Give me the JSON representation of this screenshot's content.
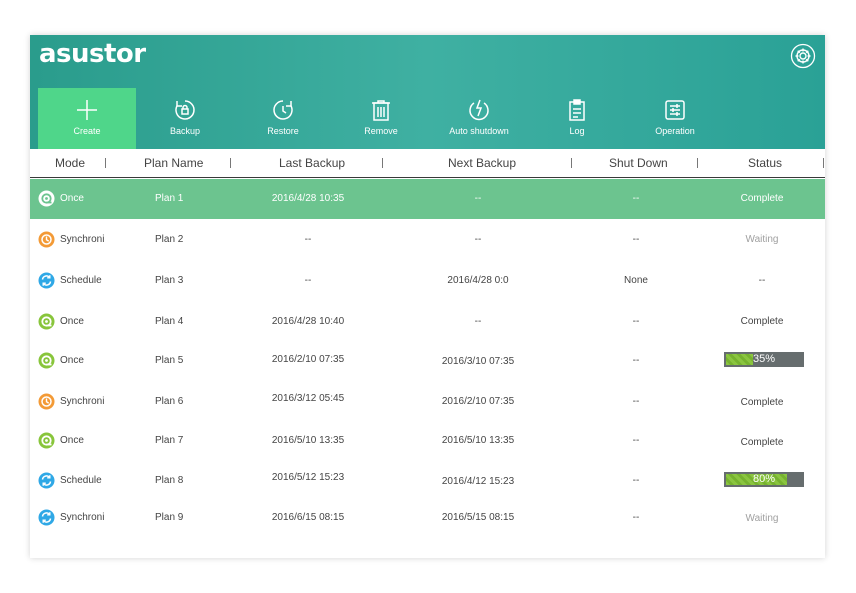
{
  "app": {
    "logo": "asustor"
  },
  "toolbar": {
    "create": "Create",
    "backup": "Backup",
    "restore": "Restore",
    "remove": "Remove",
    "auto_shutdown": "Auto shutdown",
    "log": "Log",
    "operation": "Operation"
  },
  "columns": {
    "mode": "Mode",
    "plan_name": "Plan Name",
    "last_backup": "Last Backup",
    "next_backup": "Next Backup",
    "shut_down": "Shut Down",
    "status": "Status"
  },
  "colors": {
    "once": "#88c53b",
    "synchroni": "#f39a36",
    "schedule": "#2fa8e6",
    "selected_row": "#6cc48f",
    "header": "#2a9c8c"
  },
  "rows": [
    {
      "mode": "Once",
      "mode_icon": "once-icon",
      "plan": "Plan 1",
      "last": "2016/4/28 10:35",
      "next": "--",
      "shutdown": "--",
      "status": "Complete",
      "status_color": "#ffffff"
    },
    {
      "mode": "Synchroni",
      "mode_icon": "synchroni-icon",
      "plan": "Plan 2",
      "last": "--",
      "next": "--",
      "shutdown": "--",
      "status": "Waiting",
      "status_color": "#a0a0a0"
    },
    {
      "mode": "Schedule",
      "mode_icon": "schedule-icon",
      "plan": "Plan 3",
      "last": "--",
      "next": "2016/4/28 0:0",
      "shutdown": "None",
      "status": "--",
      "status_color": "#444444"
    },
    {
      "mode": "Once",
      "mode_icon": "once-icon",
      "plan": "Plan 4",
      "last": "2016/4/28 10:40",
      "next": "--",
      "shutdown": "--",
      "status": "Complete",
      "status_color": "#444444"
    },
    {
      "mode": "Once",
      "mode_icon": "once-icon",
      "plan": "Plan 5",
      "last": "2016/2/10 07:35",
      "next": "2016/3/10 07:35",
      "shutdown": "--",
      "progress": "35%",
      "progress_value": 0.35
    },
    {
      "mode": "Synchroni",
      "mode_icon": "synchroni-icon",
      "plan": "Plan 6",
      "last": "2016/3/12  05:45",
      "next": "2016/2/10 07:35",
      "shutdown": "--",
      "status": "Complete",
      "status_color": "#444444"
    },
    {
      "mode": "Once",
      "mode_icon": "once-icon",
      "plan": "Plan 7",
      "last": "2016/5/10 13:35",
      "next": "2016/5/10 13:35",
      "shutdown": "--",
      "status": "Complete",
      "status_color": "#444444"
    },
    {
      "mode": "Schedule",
      "mode_icon": "schedule-icon",
      "plan": "Plan 8",
      "last": "2016/5/12 15:23",
      "next": "2016/4/12 15:23",
      "shutdown": "--",
      "progress": "80%",
      "progress_value": 0.8
    },
    {
      "mode": "Synchroni",
      "mode_icon": "schedule-icon",
      "plan": "Plan 9",
      "last": "2016/6/15  08:15",
      "next": "2016/5/15 08:15",
      "shutdown": "--",
      "status": "Waiting",
      "status_color": "#a0a0a0"
    }
  ]
}
